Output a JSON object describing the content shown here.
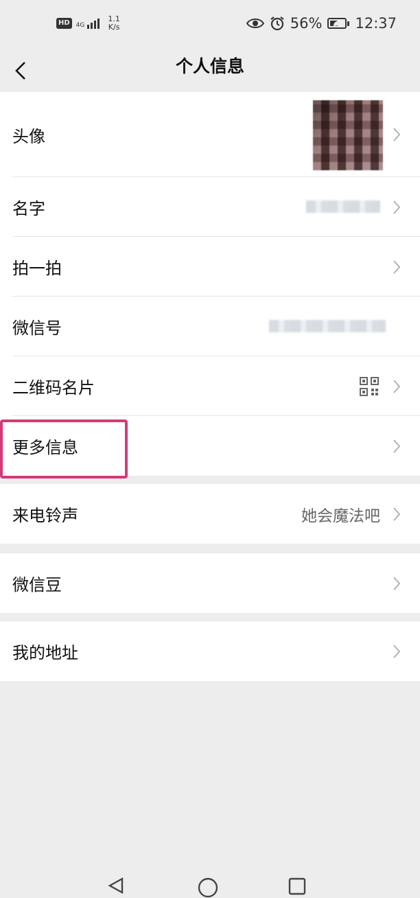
{
  "status_bar": {
    "hd": "HD",
    "network": "4G",
    "speed_value": "1.1",
    "speed_unit": "K/s",
    "battery": "56%",
    "battery_level": 0.56,
    "time": "12:37",
    "icons": [
      "eye-icon",
      "alarm-icon",
      "battery-saver-icon"
    ]
  },
  "header": {
    "title": "个人信息",
    "back_icon": "chevron-left-icon"
  },
  "profile_group": {
    "items": [
      {
        "label": "头像"
      },
      {
        "label": "名字"
      },
      {
        "label": "拍一拍"
      },
      {
        "label": "微信号"
      },
      {
        "label": "二维码名片"
      },
      {
        "label": "更多信息"
      }
    ]
  },
  "ringtone_group": {
    "label": "来电铃声",
    "value": "她会魔法吧"
  },
  "beans_group": {
    "label": "微信豆"
  },
  "address_group": {
    "label": "我的地址"
  },
  "colors": {
    "background": "#ededed",
    "highlight": "#d33b78"
  }
}
